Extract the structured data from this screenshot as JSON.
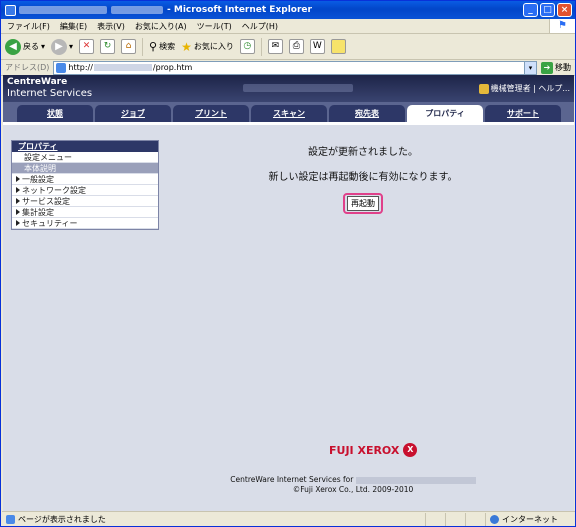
{
  "window": {
    "title": "- Microsoft Internet Explorer"
  },
  "menu": [
    "ファイル(F)",
    "編集(E)",
    "表示(V)",
    "お気に入り(A)",
    "ツール(T)",
    "ヘルプ(H)"
  ],
  "toolbar": {
    "back": "戻る",
    "search": "検索",
    "favorites": "お気に入り"
  },
  "address": {
    "label": "アドレス(D)",
    "prefix": "http://",
    "suffix": "/prop.htm",
    "go": "移動"
  },
  "banner": {
    "brand_line1": "CentreWare",
    "brand_line2": "Internet Services",
    "admin": "機械管理者 | ヘルプ..."
  },
  "tabs": [
    "状態",
    "ジョブ",
    "プリント",
    "スキャン",
    "宛先表",
    "プロパティ",
    "サポート"
  ],
  "sidebar": {
    "header": "プロパティ",
    "items": [
      "設定メニュー",
      "本体説明"
    ],
    "groups": [
      "一般設定",
      "ネットワーク設定",
      "サービス設定",
      "集計設定",
      "セキュリティー"
    ]
  },
  "main": {
    "message1": "設定が更新されました。",
    "message2": "新しい設定は再起動後に有効になります。",
    "restart_label": "再起動"
  },
  "logo": {
    "text": "FUJI XEROX"
  },
  "footer": {
    "line1": "CentreWare Internet Services for",
    "line2": "©Fuji Xerox Co., Ltd. 2009-2010"
  },
  "status": {
    "message": "ページが表示されました",
    "zone": "インターネット"
  }
}
